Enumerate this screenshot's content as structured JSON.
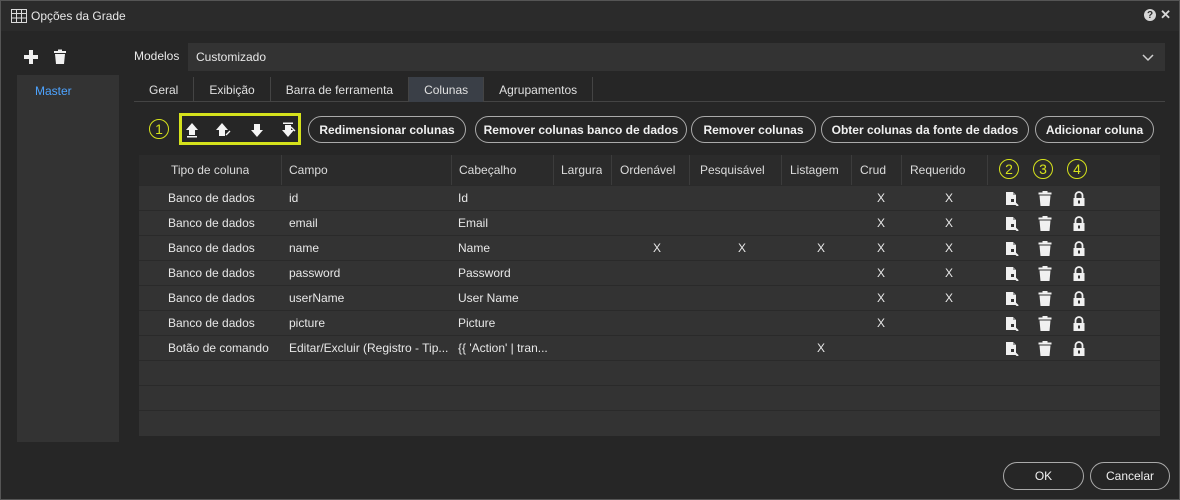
{
  "window": {
    "title": "Opções da Grade"
  },
  "sidebar": {
    "items": [
      {
        "label": "Master"
      }
    ]
  },
  "modelos": {
    "label": "Modelos",
    "value": "Customizado"
  },
  "tabs": [
    {
      "label": "Geral"
    },
    {
      "label": "Exibição"
    },
    {
      "label": "Barra de ferramenta"
    },
    {
      "label": "Colunas"
    },
    {
      "label": "Agrupamentos"
    }
  ],
  "active_tab": "Colunas",
  "annotations": [
    "1",
    "2",
    "3",
    "4"
  ],
  "toolbar": {
    "resize": "Redimensionar colunas",
    "remove_db": "Remover colunas banco de dados",
    "remove": "Remover colunas",
    "get_from_source": "Obter colunas da fonte de dados",
    "add": "Adicionar coluna"
  },
  "grid": {
    "headers": [
      "Tipo de coluna",
      "Campo",
      "Cabeçalho",
      "Largura",
      "Ordenável",
      "Pesquisável",
      "Listagem",
      "Crud",
      "Requerido"
    ],
    "rows": [
      {
        "tipo": "Banco de dados",
        "campo": "id",
        "cabecalho": "Id",
        "largura": "",
        "ordenavel": "",
        "pesquisavel": "",
        "listagem": "",
        "crud": "X",
        "requerido": "X"
      },
      {
        "tipo": "Banco de dados",
        "campo": "email",
        "cabecalho": "Email",
        "largura": "",
        "ordenavel": "",
        "pesquisavel": "",
        "listagem": "",
        "crud": "X",
        "requerido": "X"
      },
      {
        "tipo": "Banco de dados",
        "campo": "name",
        "cabecalho": "Name",
        "largura": "",
        "ordenavel": "X",
        "pesquisavel": "X",
        "listagem": "X",
        "crud": "X",
        "requerido": "X"
      },
      {
        "tipo": "Banco de dados",
        "campo": "password",
        "cabecalho": "Password",
        "largura": "",
        "ordenavel": "",
        "pesquisavel": "",
        "listagem": "",
        "crud": "X",
        "requerido": "X"
      },
      {
        "tipo": "Banco de dados",
        "campo": "userName",
        "cabecalho": "User Name",
        "largura": "",
        "ordenavel": "",
        "pesquisavel": "",
        "listagem": "",
        "crud": "X",
        "requerido": "X"
      },
      {
        "tipo": "Banco de dados",
        "campo": "picture",
        "cabecalho": "Picture",
        "largura": "",
        "ordenavel": "",
        "pesquisavel": "",
        "listagem": "",
        "crud": "X",
        "requerido": ""
      },
      {
        "tipo": "Botão de comando",
        "campo": "Editar/Excluir (Registro - Tip...",
        "cabecalho": "{{ 'Action' | tran...",
        "largura": "",
        "ordenavel": "",
        "pesquisavel": "",
        "listagem": "X",
        "crud": "",
        "requerido": ""
      }
    ],
    "empty_rows": 3
  },
  "footer": {
    "ok": "OK",
    "cancel": "Cancelar"
  },
  "colors": {
    "accent": "#d5e21c",
    "link": "#4da3ff",
    "background": "#262626",
    "panel": "#333333"
  },
  "icons": [
    "grid-icon",
    "help-icon",
    "close-icon",
    "plus-icon",
    "trash-icon",
    "chevron-down-icon",
    "move-first-icon",
    "move-up-icon",
    "move-down-icon",
    "move-last-icon",
    "edit-icon",
    "delete-icon",
    "lock-icon"
  ]
}
